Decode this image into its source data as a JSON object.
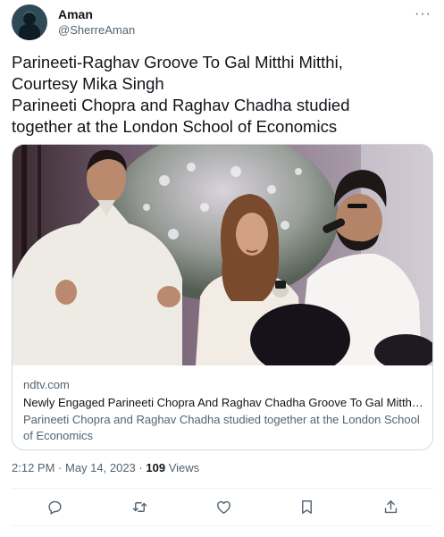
{
  "author": {
    "name": "Aman",
    "handle": "@SherreAman",
    "more_icon": "ellipsis-icon"
  },
  "tweet": {
    "lines": [
      "Parineeti-Raghav Groove To Gal Mitthi Mitthi,",
      "Courtesy Mika Singh",
      "Parineeti Chopra and Raghav Chadha studied",
      "together at the London School of Economics"
    ]
  },
  "card": {
    "domain": "ndtv.com",
    "title": "Newly Engaged Parineeti Chopra And Raghav Chadha Groove To Gal Mitthi M...",
    "description": "Parineeti Chopra and Raghav Chadha studied together at the London School of Economics"
  },
  "meta": {
    "time": "2:12 PM",
    "separator": "·",
    "date": "May 14, 2023",
    "views_count": "109",
    "views_label": "Views"
  },
  "actions": [
    "reply-icon",
    "retweet-icon",
    "like-icon",
    "bookmark-icon",
    "share-icon"
  ],
  "colors": {
    "text": "#0f1419",
    "secondary": "#536471",
    "border": "#cfd9de"
  }
}
